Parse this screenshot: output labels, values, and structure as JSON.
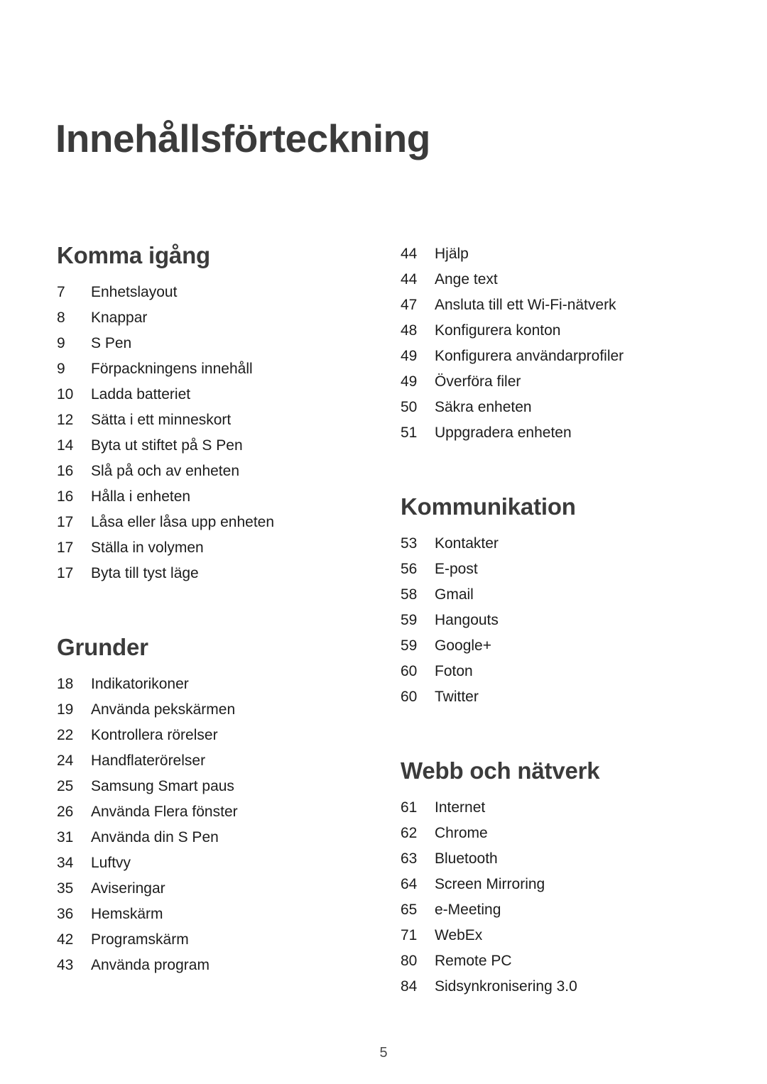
{
  "document": {
    "title": "Innehållsförteckning",
    "page_number": "5"
  },
  "colors": {
    "heading": "#3b3b3b",
    "body": "#1c1c1c",
    "background": "#ffffff"
  },
  "columns": {
    "left": {
      "sections": [
        {
          "heading": "Komma igång",
          "entries": [
            {
              "page": "7",
              "label": "Enhetslayout"
            },
            {
              "page": "8",
              "label": "Knappar"
            },
            {
              "page": "9",
              "label": "S Pen"
            },
            {
              "page": "9",
              "label": "Förpackningens innehåll"
            },
            {
              "page": "10",
              "label": "Ladda batteriet"
            },
            {
              "page": "12",
              "label": "Sätta i ett minneskort"
            },
            {
              "page": "14",
              "label": "Byta ut stiftet på S Pen"
            },
            {
              "page": "16",
              "label": "Slå på och av enheten"
            },
            {
              "page": "16",
              "label": "Hålla i enheten"
            },
            {
              "page": "17",
              "label": "Låsa eller låsa upp enheten"
            },
            {
              "page": "17",
              "label": "Ställa in volymen"
            },
            {
              "page": "17",
              "label": "Byta till tyst läge"
            }
          ]
        },
        {
          "heading": "Grunder",
          "entries": [
            {
              "page": "18",
              "label": "Indikatorikoner"
            },
            {
              "page": "19",
              "label": "Använda pekskärmen"
            },
            {
              "page": "22",
              "label": "Kontrollera rörelser"
            },
            {
              "page": "24",
              "label": "Handflaterörelser"
            },
            {
              "page": "25",
              "label": "Samsung Smart paus"
            },
            {
              "page": "26",
              "label": "Använda Flera fönster"
            },
            {
              "page": "31",
              "label": "Använda din S Pen"
            },
            {
              "page": "34",
              "label": "Luftvy"
            },
            {
              "page": "35",
              "label": "Aviseringar"
            },
            {
              "page": "36",
              "label": "Hemskärm"
            },
            {
              "page": "42",
              "label": "Programskärm"
            },
            {
              "page": "43",
              "label": "Använda program"
            }
          ]
        }
      ]
    },
    "right": {
      "sections": [
        {
          "heading": "",
          "entries": [
            {
              "page": "44",
              "label": "Hjälp"
            },
            {
              "page": "44",
              "label": "Ange text"
            },
            {
              "page": "47",
              "label": "Ansluta till ett Wi-Fi-nätverk"
            },
            {
              "page": "48",
              "label": "Konfigurera konton"
            },
            {
              "page": "49",
              "label": "Konfigurera användarprofiler"
            },
            {
              "page": "49",
              "label": "Överföra filer"
            },
            {
              "page": "50",
              "label": "Säkra enheten"
            },
            {
              "page": "51",
              "label": "Uppgradera enheten"
            }
          ]
        },
        {
          "heading": "Kommunikation",
          "entries": [
            {
              "page": "53",
              "label": "Kontakter"
            },
            {
              "page": "56",
              "label": "E-post"
            },
            {
              "page": "58",
              "label": "Gmail"
            },
            {
              "page": "59",
              "label": "Hangouts"
            },
            {
              "page": "59",
              "label": "Google+"
            },
            {
              "page": "60",
              "label": "Foton"
            },
            {
              "page": "60",
              "label": "Twitter"
            }
          ]
        },
        {
          "heading": "Webb och nätverk",
          "entries": [
            {
              "page": "61",
              "label": "Internet"
            },
            {
              "page": "62",
              "label": "Chrome"
            },
            {
              "page": "63",
              "label": "Bluetooth"
            },
            {
              "page": "64",
              "label": "Screen Mirroring"
            },
            {
              "page": "65",
              "label": "e-Meeting"
            },
            {
              "page": "71",
              "label": "WebEx"
            },
            {
              "page": "80",
              "label": "Remote PC"
            },
            {
              "page": "84",
              "label": "Sidsynkronisering 3.0"
            }
          ]
        }
      ]
    }
  }
}
